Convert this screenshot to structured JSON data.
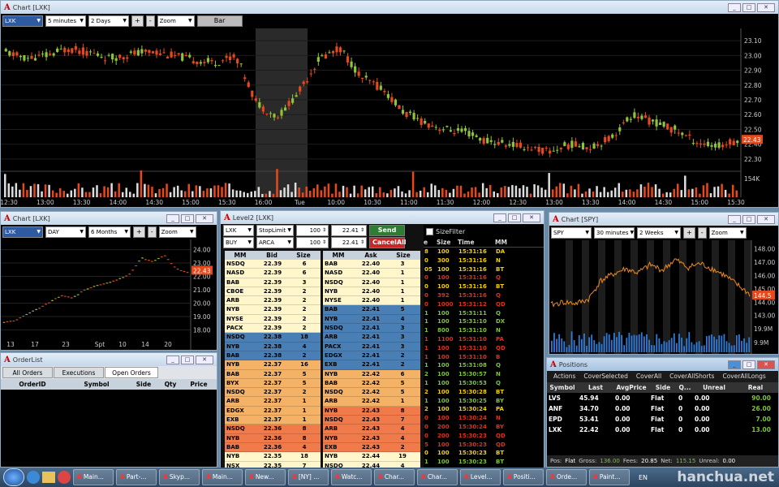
{
  "chart_main": {
    "title": "Chart [LXK]",
    "symbol": "LXK",
    "interval": "5 minutes",
    "range": "2 Days",
    "zoom": "Zoom",
    "plus": "+",
    "minus": "-",
    "style_button": "Bar",
    "price_labels": [
      "23.10",
      "23.00",
      "22.90",
      "22.80",
      "22.70",
      "22.60",
      "22.50",
      "22.40",
      "22.30"
    ],
    "last_price": "22.43",
    "volume_label": "154K",
    "time_labels": [
      "12:30",
      "13:00",
      "13:30",
      "14:00",
      "14:30",
      "15:00",
      "15:30",
      "16:00",
      "Tue",
      "10:00",
      "10:30",
      "11:00",
      "11:30",
      "12:00",
      "12:30",
      "13:00",
      "13:30",
      "14:00",
      "14:30",
      "15:00",
      "15:30"
    ]
  },
  "chart_daily": {
    "title": "Chart [LXK]",
    "symbol": "LXK",
    "interval": "DAY",
    "range": "6 Months",
    "zoom": "Zoom",
    "plus": "+",
    "minus": "-",
    "price_labels": [
      "24.00",
      "23.00",
      "22.00",
      "21.00",
      "20.00",
      "19.00",
      "18.00"
    ],
    "last_price": "22.43",
    "time_labels": [
      "13",
      "17",
      "23",
      "Spt",
      "10",
      "14",
      "20"
    ]
  },
  "level2": {
    "title": "Level2 [LXK]",
    "symbol": "LXK",
    "order_type": "StopLimit",
    "qty1": "100",
    "price1": "22.41",
    "send": "Send",
    "side": "BUY",
    "route": "ARCA",
    "qty2": "100",
    "price2": "22.41",
    "cancel_all": "CancelAll",
    "bid_headers": [
      "MM",
      "Bid",
      "Size"
    ],
    "ask_headers": [
      "MM",
      "Ask",
      "Size"
    ],
    "bids": [
      [
        "NSDQ",
        "22.39",
        "6",
        "y"
      ],
      [
        "NASD",
        "22.39",
        "6",
        "y"
      ],
      [
        "BAB",
        "22.39",
        "3",
        "y"
      ],
      [
        "CBOE",
        "22.39",
        "2",
        "y"
      ],
      [
        "ARB",
        "22.39",
        "2",
        "y"
      ],
      [
        "NYB",
        "22.39",
        "2",
        "y"
      ],
      [
        "NYSE",
        "22.39",
        "2",
        "y"
      ],
      [
        "PACX",
        "22.39",
        "2",
        "y"
      ],
      [
        "NSDQ",
        "22.38",
        "18",
        "b"
      ],
      [
        "NYB",
        "22.38",
        "4",
        "b"
      ],
      [
        "BAB",
        "22.38",
        "2",
        "b"
      ],
      [
        "NYB",
        "22.37",
        "16",
        "o"
      ],
      [
        "BAB",
        "22.37",
        "5",
        "o"
      ],
      [
        "BYX",
        "22.37",
        "5",
        "o"
      ],
      [
        "NSDQ",
        "22.37",
        "2",
        "o"
      ],
      [
        "ARB",
        "22.37",
        "1",
        "o"
      ],
      [
        "EDGX",
        "22.37",
        "1",
        "o"
      ],
      [
        "EXB",
        "22.37",
        "1",
        "o"
      ],
      [
        "NSDQ",
        "22.36",
        "8",
        "r"
      ],
      [
        "NYB",
        "22.36",
        "8",
        "r"
      ],
      [
        "BAB",
        "22.36",
        "4",
        "r"
      ],
      [
        "NYB",
        "22.35",
        "18",
        "y"
      ],
      [
        "NSX",
        "22.35",
        "7",
        "y"
      ],
      [
        "EXB",
        "22.35",
        "5",
        "y"
      ]
    ],
    "asks": [
      [
        "BAB",
        "22.40",
        "3",
        "y"
      ],
      [
        "NASD",
        "22.40",
        "1",
        "y"
      ],
      [
        "NSDQ",
        "22.40",
        "1",
        "y"
      ],
      [
        "NYB",
        "22.40",
        "1",
        "y"
      ],
      [
        "NYSE",
        "22.40",
        "1",
        "y"
      ],
      [
        "BAB",
        "22.41",
        "5",
        "b"
      ],
      [
        "NYB",
        "22.41",
        "4",
        "b"
      ],
      [
        "NSDQ",
        "22.41",
        "3",
        "b"
      ],
      [
        "ARB",
        "22.41",
        "3",
        "b"
      ],
      [
        "PACX",
        "22.41",
        "3",
        "b"
      ],
      [
        "EDGX",
        "22.41",
        "2",
        "b"
      ],
      [
        "EXB",
        "22.41",
        "2",
        "b"
      ],
      [
        "NYB",
        "22.42",
        "6",
        "o"
      ],
      [
        "BAB",
        "22.42",
        "5",
        "o"
      ],
      [
        "NSDQ",
        "22.42",
        "5",
        "o"
      ],
      [
        "ARB",
        "22.42",
        "1",
        "o"
      ],
      [
        "NYB",
        "22.43",
        "8",
        "r"
      ],
      [
        "NSDQ",
        "22.43",
        "7",
        "r"
      ],
      [
        "ARB",
        "22.43",
        "4",
        "r"
      ],
      [
        "NYB",
        "22.43",
        "4",
        "r"
      ],
      [
        "EXB",
        "22.43",
        "2",
        "r"
      ],
      [
        "NYB",
        "22.44",
        "19",
        "y"
      ],
      [
        "NSDQ",
        "22.44",
        "4",
        "y"
      ],
      [
        "NSX",
        "22.44",
        "4",
        "y"
      ]
    ]
  },
  "tape": {
    "size_filter": "SizeFilter",
    "headers": [
      "e",
      "Size",
      "Time",
      "MM"
    ],
    "rows": [
      [
        "8",
        "100",
        "15:31:16",
        "DA",
        "y"
      ],
      [
        "0",
        "300",
        "15:31:16",
        "N",
        "y"
      ],
      [
        "05",
        "100",
        "15:31:16",
        "BT",
        "y"
      ],
      [
        "0",
        "100",
        "15:31:16",
        "Q",
        "r"
      ],
      [
        "0",
        "100",
        "15:31:16",
        "BT",
        "y"
      ],
      [
        "0",
        "392",
        "15:31:16",
        "Q",
        "r"
      ],
      [
        "0",
        "1000",
        "15:31:12",
        "QD",
        "r"
      ],
      [
        "1",
        "100",
        "15:31:11",
        "Q",
        "g"
      ],
      [
        "1",
        "100",
        "15:31:10",
        "DX",
        "g"
      ],
      [
        "1",
        "800",
        "15:31:10",
        "N",
        "g"
      ],
      [
        "1",
        "1100",
        "15:31:10",
        "PA",
        "r"
      ],
      [
        "1",
        "100",
        "15:31:10",
        "QD",
        "r"
      ],
      [
        "1",
        "100",
        "15:31:10",
        "B",
        "r"
      ],
      [
        "1",
        "100",
        "15:31:08",
        "Q",
        "g"
      ],
      [
        "2",
        "100",
        "15:30:57",
        "N",
        "g"
      ],
      [
        "1",
        "100",
        "15:30:53",
        "Q",
        "g"
      ],
      [
        "2",
        "100",
        "15:30:28",
        "BT",
        "y"
      ],
      [
        "1",
        "100",
        "15:30:25",
        "BY",
        "g"
      ],
      [
        "2",
        "100",
        "15:30:24",
        "PA",
        "y"
      ],
      [
        "0",
        "100",
        "15:30:24",
        "N",
        "r"
      ],
      [
        "0",
        "200",
        "15:30:24",
        "BY",
        "r"
      ],
      [
        "0",
        "200",
        "15:30:23",
        "QD",
        "r"
      ],
      [
        "5",
        "100",
        "15:30:23",
        "QD",
        "r"
      ],
      [
        "0",
        "100",
        "15:30:23",
        "BT",
        "y"
      ],
      [
        "1",
        "100",
        "15:30:23",
        "BT",
        "g"
      ],
      [
        "1",
        "100",
        "15:30:23",
        "PA",
        "g"
      ]
    ]
  },
  "chart_spy": {
    "title": "Chart [SPY]",
    "symbol": "SPY",
    "interval": "30 minutes",
    "range": "2 Weeks",
    "zoom": "Zoom",
    "plus": "+",
    "minus": "-",
    "price_labels": [
      "148.00",
      "147.00",
      "146.00",
      "145.00",
      "144.00",
      "143.00"
    ],
    "last_price": "144.5",
    "volume_label": "19.9M",
    "volume_label2": "9.9M"
  },
  "orderlist": {
    "title": "OrderList",
    "tabs": [
      "All Orders",
      "Executions",
      "Open Orders"
    ],
    "headers": [
      "OrderID",
      "Symbol",
      "Side",
      "Qty",
      "Price"
    ]
  },
  "positions": {
    "title": "Positions",
    "menu": [
      "Actions",
      "CoverSelected",
      "CoverAll",
      "CoverAllShorts",
      "CoverAllLongs"
    ],
    "headers": [
      "Symbol",
      "Last",
      "AvgPrice",
      "Side",
      "Q...",
      "Unreal",
      "Real"
    ],
    "rows": [
      [
        "LVS",
        "45.94",
        "0.00",
        "Flat",
        "0",
        "0.00",
        "90.00"
      ],
      [
        "ANF",
        "34.70",
        "0.00",
        "Flat",
        "0",
        "0.00",
        "26.00"
      ],
      [
        "EPD",
        "53.41",
        "0.00",
        "Flat",
        "0",
        "0.00",
        "7.00"
      ],
      [
        "LXK",
        "22.42",
        "0.00",
        "Flat",
        "0",
        "0.00",
        "13.00"
      ]
    ],
    "footer": {
      "pos_label": "Pos:",
      "pos_value": "Flat",
      "gross_label": "Gross:",
      "gross_value": "136.00",
      "fees_label": "Fees:",
      "fees_value": "20.85",
      "net_label": "Net:",
      "net_value": "115.15",
      "unreal_label": "Unreal:",
      "unreal_value": "0.00"
    }
  },
  "taskbar": {
    "items": [
      "Main...",
      "Part-...",
      "Skyp...",
      "Main...",
      "New...",
      "[NY] ...",
      "Watc...",
      "Char...",
      "Char...",
      "Level...",
      "Positi...",
      "Orde...",
      "Paint..."
    ],
    "lang": "EN",
    "watermark": "hanchua.net"
  },
  "colors": {
    "yellow": "#fff6cc",
    "blue": "#4a7fb5",
    "orange": "#f4b266",
    "red": "#f07a4a",
    "up": "#8fc43a",
    "down": "#e8491a"
  }
}
